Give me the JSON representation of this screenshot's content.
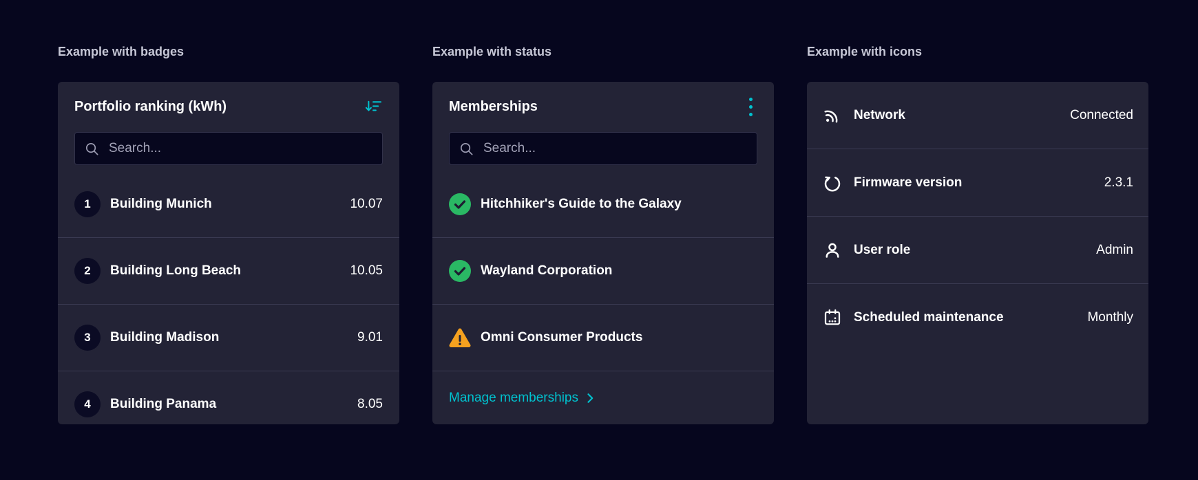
{
  "colors": {
    "accent_teal": "#00c2cf",
    "success_green": "#2ab864",
    "warning_orange": "#f5a11f",
    "card_background": "#232336",
    "page_background": "#06061e"
  },
  "sections": [
    {
      "label": "Example with badges",
      "card": {
        "title": "Portfolio ranking (kWh)",
        "header_icon": "sort-descending-icon",
        "search": {
          "placeholder": "Search...",
          "icon": "search-icon"
        },
        "items": [
          {
            "badge": "1",
            "name": "Building Munich",
            "value": "10.07"
          },
          {
            "badge": "2",
            "name": "Building Long Beach",
            "value": "10.05"
          },
          {
            "badge": "3",
            "name": "Building Madison",
            "value": "9.01"
          },
          {
            "badge": "4",
            "name": "Building Panama",
            "value": "8.05"
          }
        ]
      }
    },
    {
      "label": "Example with status",
      "card": {
        "title": "Memberships",
        "header_icon": "kebab-menu-icon",
        "search": {
          "placeholder": "Search...",
          "icon": "search-icon"
        },
        "items": [
          {
            "status": "success",
            "icon": "status-success-icon",
            "name": "Hitchhiker's Guide to the Galaxy"
          },
          {
            "status": "success",
            "icon": "status-success-icon",
            "name": "Wayland Corporation"
          },
          {
            "status": "warning",
            "icon": "status-warning-icon",
            "name": "Omni Consumer Products"
          }
        ],
        "footer_link": {
          "label": "Manage memberships",
          "icon": "chevron-right-icon"
        }
      }
    },
    {
      "label": "Example with icons",
      "card": {
        "items": [
          {
            "icon": "network-icon",
            "label": "Network",
            "value": "Connected"
          },
          {
            "icon": "firmware-refresh-icon",
            "label": "Firmware version",
            "value": "2.3.1"
          },
          {
            "icon": "user-icon",
            "label": "User role",
            "value": "Admin"
          },
          {
            "icon": "calendar-icon",
            "label": "Scheduled maintenance",
            "value": "Monthly"
          }
        ]
      }
    }
  ]
}
